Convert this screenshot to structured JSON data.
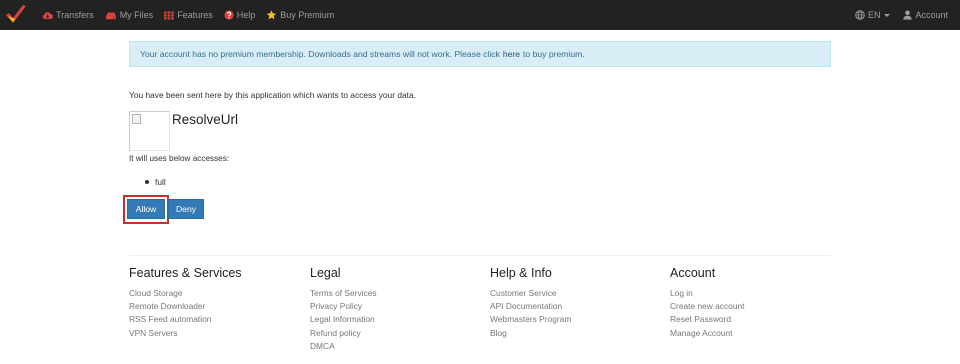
{
  "navbar": {
    "left_items": [
      {
        "label": "Transfers",
        "icon": "cloud-download-icon"
      },
      {
        "label": "My Files",
        "icon": "hdd-icon"
      },
      {
        "label": "Features",
        "icon": "grid-icon"
      },
      {
        "label": "Help",
        "icon": "question-circle-icon"
      },
      {
        "label": "Buy Premium",
        "icon": "star-icon"
      }
    ],
    "language": "EN",
    "account_label": "Account",
    "colors": {
      "background": "#222222",
      "text": "#9d9d9d",
      "icon_red": "#d9433d",
      "star_yellow": "#f0c419"
    }
  },
  "alert": {
    "text_before": "Your account has no premium membership. Downloads and streams will not work. Please click",
    "link_label": "here",
    "text_after": "to buy premium."
  },
  "main": {
    "intro": "You have been sent here by this application which wants to access your data.",
    "app_name": "ResolveUrl",
    "uses_label": "It will uses below accesses:",
    "accesses": [
      "full"
    ],
    "allow_label": "Allow",
    "deny_label": "Deny"
  },
  "footer": {
    "columns": [
      {
        "title": "Features & Services",
        "links": [
          "Cloud Storage",
          "Remote Downloader",
          "RSS Feed automation",
          "VPN Servers"
        ]
      },
      {
        "title": "Legal",
        "links": [
          "Terms of Services",
          "Privacy Policy",
          "Legal Information",
          "Refund policy",
          "DMCA"
        ]
      },
      {
        "title": "Help & Info",
        "links": [
          "Customer Service",
          "API Documentation",
          "Webmasters Program",
          "Blog"
        ]
      },
      {
        "title": "Account",
        "links": [
          "Log in",
          "Create new account",
          "Reset Password",
          "Manage Account"
        ]
      }
    ]
  }
}
